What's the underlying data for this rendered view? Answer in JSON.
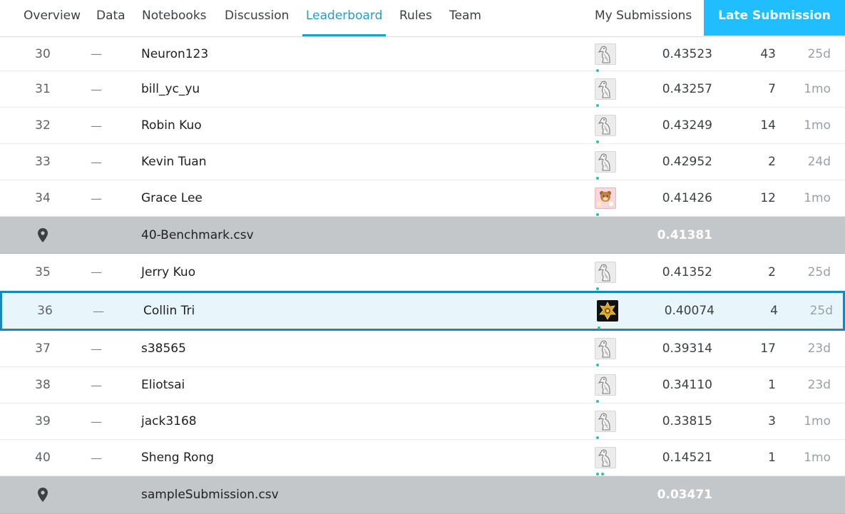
{
  "nav": {
    "tabs": [
      {
        "label": "Overview",
        "active": false
      },
      {
        "label": "Data",
        "active": false
      },
      {
        "label": "Notebooks",
        "active": false
      },
      {
        "label": "Discussion",
        "active": false
      },
      {
        "label": "Leaderboard",
        "active": true
      },
      {
        "label": "Rules",
        "active": false
      },
      {
        "label": "Team",
        "active": false
      }
    ],
    "my_submissions": "My Submissions",
    "late_submission": "Late Submission",
    "accent_color": "#20a0c8",
    "button_color": "#20beff"
  },
  "rows": [
    {
      "type": "team",
      "rank": "30",
      "change": "—",
      "name": "Neuron123",
      "avatar": "goose-icon",
      "score": "0.43523",
      "entries": "43",
      "last": "25d",
      "dots": 1
    },
    {
      "type": "team",
      "rank": "31",
      "change": "—",
      "name": "bill_yc_yu",
      "avatar": "goose-icon",
      "score": "0.43257",
      "entries": "7",
      "last": "1mo",
      "dots": 1
    },
    {
      "type": "team",
      "rank": "32",
      "change": "—",
      "name": "Robin Kuo",
      "avatar": "goose-icon",
      "score": "0.43249",
      "entries": "14",
      "last": "1mo",
      "dots": 1
    },
    {
      "type": "team",
      "rank": "33",
      "change": "—",
      "name": "Kevin Tuan",
      "avatar": "goose-icon",
      "score": "0.42952",
      "entries": "2",
      "last": "24d",
      "dots": 1
    },
    {
      "type": "team",
      "rank": "34",
      "change": "—",
      "name": "Grace Lee",
      "avatar": "bear-icon",
      "score": "0.41426",
      "entries": "12",
      "last": "1mo",
      "dots": 1
    },
    {
      "type": "benchmark",
      "name": "40-Benchmark.csv",
      "icon": "map-pin-icon",
      "score": "0.41381"
    },
    {
      "type": "team",
      "rank": "35",
      "change": "—",
      "name": "Jerry Kuo",
      "avatar": "goose-icon",
      "score": "0.41352",
      "entries": "2",
      "last": "25d",
      "dots": 1
    },
    {
      "type": "team",
      "rank": "36",
      "change": "—",
      "name": "Collin Tri",
      "avatar": "gold-emblem-icon",
      "score": "0.40074",
      "entries": "4",
      "last": "25d",
      "dots": 1,
      "highlight": true
    },
    {
      "type": "team",
      "rank": "37",
      "change": "—",
      "name": "s38565",
      "avatar": "goose-icon",
      "score": "0.39314",
      "entries": "17",
      "last": "23d",
      "dots": 1
    },
    {
      "type": "team",
      "rank": "38",
      "change": "—",
      "name": "Eliotsai",
      "avatar": "goose-icon",
      "score": "0.34110",
      "entries": "1",
      "last": "23d",
      "dots": 1
    },
    {
      "type": "team",
      "rank": "39",
      "change": "—",
      "name": "jack3168",
      "avatar": "goose-icon",
      "score": "0.33815",
      "entries": "3",
      "last": "1mo",
      "dots": 1
    },
    {
      "type": "team",
      "rank": "40",
      "change": "—",
      "name": "Sheng Rong",
      "avatar": "goose-icon",
      "score": "0.14521",
      "entries": "1",
      "last": "1mo",
      "dots": 2
    },
    {
      "type": "benchmark",
      "name": "sampleSubmission.csv",
      "icon": "map-pin-icon",
      "score": "0.03471"
    }
  ]
}
